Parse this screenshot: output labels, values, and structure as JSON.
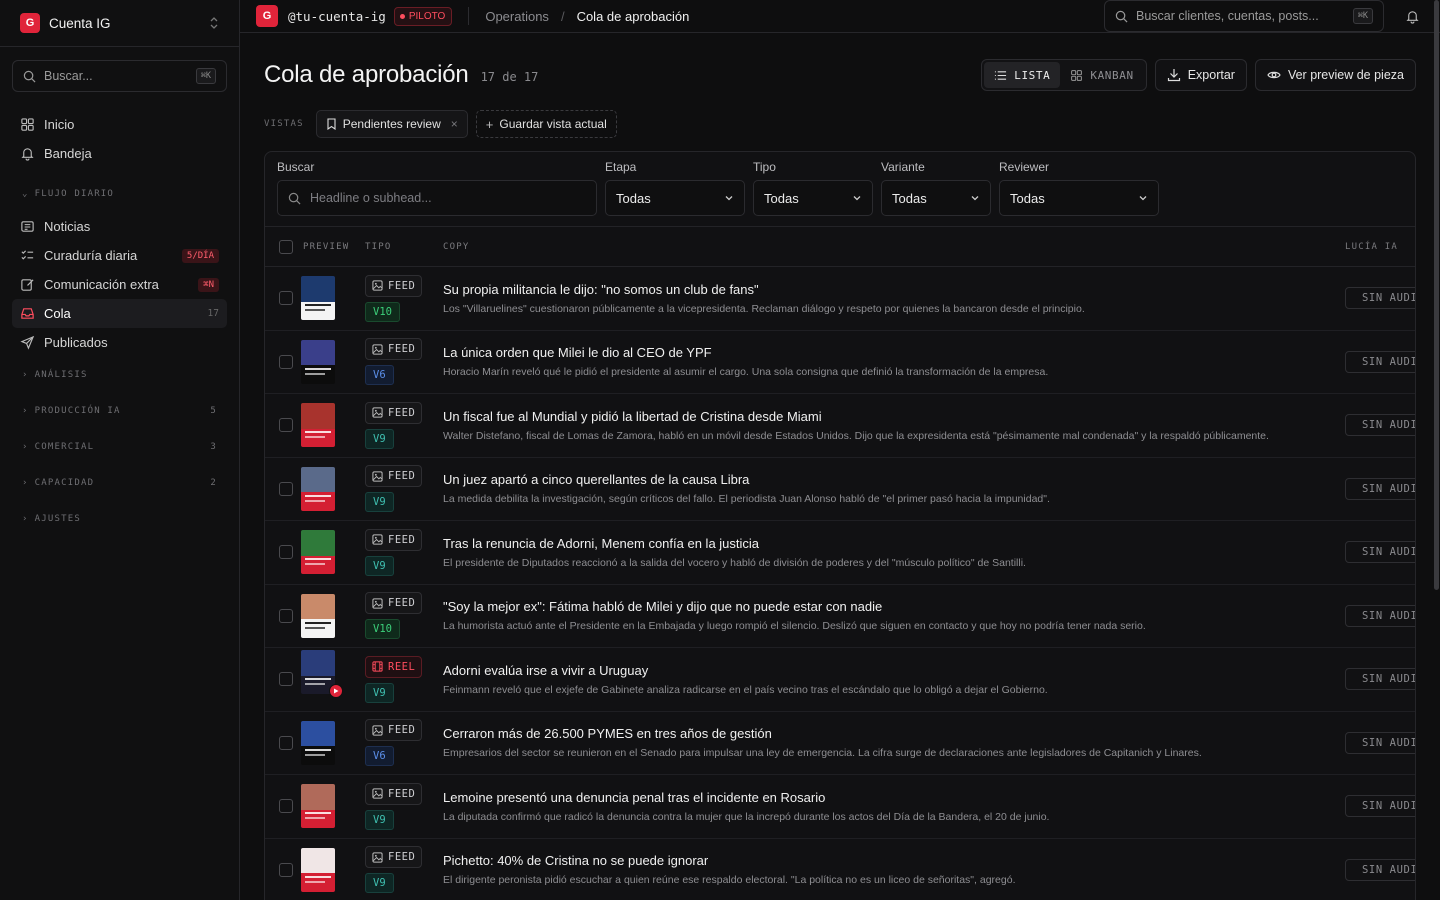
{
  "account": {
    "logo_letter": "G",
    "name": "Cuenta IG"
  },
  "sidebar": {
    "search_placeholder": "Buscar...",
    "search_kbd": "⌘K",
    "top_items": [
      {
        "label": "Inicio",
        "icon": "grid-icon"
      },
      {
        "label": "Bandeja",
        "icon": "bell-icon"
      }
    ],
    "flow_section": "FLUJO DIARIO",
    "flow_items": [
      {
        "label": "Noticias",
        "icon": "newspaper-icon",
        "badge": ""
      },
      {
        "label": "Curaduría diaria",
        "icon": "checklist-icon",
        "badge": "5/DÍA"
      },
      {
        "label": "Comunicación extra",
        "icon": "edit-icon",
        "badge": "⌘N"
      },
      {
        "label": "Cola",
        "icon": "inbox-icon",
        "count": "17"
      },
      {
        "label": "Publicados",
        "icon": "send-icon",
        "badge": ""
      }
    ],
    "sections": [
      {
        "label": "ANÁLISIS",
        "count": ""
      },
      {
        "label": "PRODUCCIÓN IA",
        "count": "5"
      },
      {
        "label": "COMERCIAL",
        "count": "3"
      },
      {
        "label": "CAPACIDAD",
        "count": "2"
      },
      {
        "label": "AJUSTES",
        "count": ""
      }
    ]
  },
  "topbar": {
    "logo_letter": "G",
    "handle": "@tu-cuenta-ig",
    "badge": "PILOTO",
    "crumb_parent": "Operations",
    "crumb_sep": "/",
    "crumb_current": "Cola de aprobación",
    "search_placeholder": "Buscar clientes, cuentas, posts...",
    "search_kbd": "⌘K"
  },
  "page": {
    "title": "Cola de aprobación",
    "count": "17 de 17",
    "view_list": "LISTA",
    "view_kanban": "KANBAN",
    "export": "Exportar",
    "preview": "Ver preview de pieza",
    "views_label": "VISTAS",
    "view_chip": "Pendientes review",
    "save_view": "Guardar vista actual"
  },
  "filters": {
    "search_label": "Buscar",
    "search_placeholder": "Headline o subhead...",
    "etapa_label": "Etapa",
    "etapa_value": "Todas",
    "tipo_label": "Tipo",
    "tipo_value": "Todas",
    "variante_label": "Variante",
    "variante_value": "Todas",
    "reviewer_label": "Reviewer",
    "reviewer_value": "Todas"
  },
  "table": {
    "columns": {
      "preview": "PREVIEW",
      "tipo": "TIPO",
      "copy": "COPY",
      "ia": "LUCÍA IA"
    },
    "ia_status": "SIN AUDITAR",
    "rows": [
      {
        "type": "FEED",
        "version": "V10",
        "vcolor": "green",
        "thumb": [
          "#1d3a6e",
          "#f4f4f4"
        ],
        "headline": "Su propia militancia le dijo: \"no somos un club de fans\"",
        "sub": "Los \"Villaruelines\" cuestionaron públicamente a la vicepresidenta. Reclaman diálogo y respeto por quienes la bancaron desde el principio."
      },
      {
        "type": "FEED",
        "version": "V6",
        "vcolor": "blue",
        "thumb": [
          "#3a3f8a",
          "#0c0c0c"
        ],
        "headline": "La única orden que Milei le dio al CEO de YPF",
        "sub": "Horacio Marín reveló qué le pidió el presidente al asumir el cargo. Una sola consigna que definió la transformación de la empresa."
      },
      {
        "type": "FEED",
        "version": "V9",
        "vcolor": "teal",
        "thumb": [
          "#a8332d",
          "#d41f33"
        ],
        "headline": "Un fiscal fue al Mundial y pidió la libertad de Cristina desde Miami",
        "sub": "Walter Distefano, fiscal de Lomas de Zamora, habló en un móvil desde Estados Unidos. Dijo que la expresidenta está \"pésimamente mal condenada\" y la respaldó públicamente."
      },
      {
        "type": "FEED",
        "version": "V9",
        "vcolor": "teal",
        "thumb": [
          "#5a6a8a",
          "#d41f33"
        ],
        "headline": "Un juez apartó a cinco querellantes de la causa Libra",
        "sub": "La medida debilita la investigación, según críticos del fallo. El periodista Juan Alonso habló de \"el primer pasó hacia la impunidad\"."
      },
      {
        "type": "FEED",
        "version": "V9",
        "vcolor": "teal",
        "thumb": [
          "#2f7a3a",
          "#d41f33"
        ],
        "headline": "Tras la renuncia de Adorni, Menem confía en la justicia",
        "sub": "El presidente de Diputados reaccionó a la salida del vocero y habló de división de poderes y del \"músculo político\" de Santilli."
      },
      {
        "type": "FEED",
        "version": "V10",
        "vcolor": "green",
        "thumb": [
          "#c98a6a",
          "#f4f4f4"
        ],
        "headline": "\"Soy la mejor ex\": Fátima habló de Milei y dijo que no puede estar con nadie",
        "sub": "La humorista actuó ante el Presidente en la Embajada y luego rompió el silencio. Deslizó que siguen en contacto y que hoy no podría tener nada serio."
      },
      {
        "type": "REEL",
        "version": "V9",
        "vcolor": "teal",
        "thumb": [
          "#2a3d7a",
          "#1a1a2a"
        ],
        "headline": "Adorni evalúa irse a vivir a Uruguay",
        "sub": "Feinmann reveló que el exjefe de Gabinete analiza radicarse en el país vecino tras el escándalo que lo obligó a dejar el Gobierno."
      },
      {
        "type": "FEED",
        "version": "V6",
        "vcolor": "blue",
        "thumb": [
          "#2c4fa0",
          "#0c0c0c"
        ],
        "headline": "Cerraron más de 26.500 PYMES en tres años de gestión",
        "sub": "Empresarios del sector se reunieron en el Senado para impulsar una ley de emergencia. La cifra surge de declaraciones ante legisladores de Capitanich y Linares."
      },
      {
        "type": "FEED",
        "version": "V9",
        "vcolor": "teal",
        "thumb": [
          "#b06a5a",
          "#d41f33"
        ],
        "headline": "Lemoine presentó una denuncia penal tras el incidente en Rosario",
        "sub": "La diputada confirmó que radicó la denuncia contra la mujer que la increpó durante los actos del Día de la Bandera, el 20 de junio."
      },
      {
        "type": "FEED",
        "version": "V9",
        "vcolor": "teal",
        "thumb": [
          "#f0e6e6",
          "#d41f33"
        ],
        "headline": "Pichetto: 40% de Cristina no se puede ignorar",
        "sub": "El dirigente peronista pidió escuchar a quien reúne ese respaldo electoral. \"La política no es un liceo de señoritas\", agregó."
      }
    ]
  }
}
